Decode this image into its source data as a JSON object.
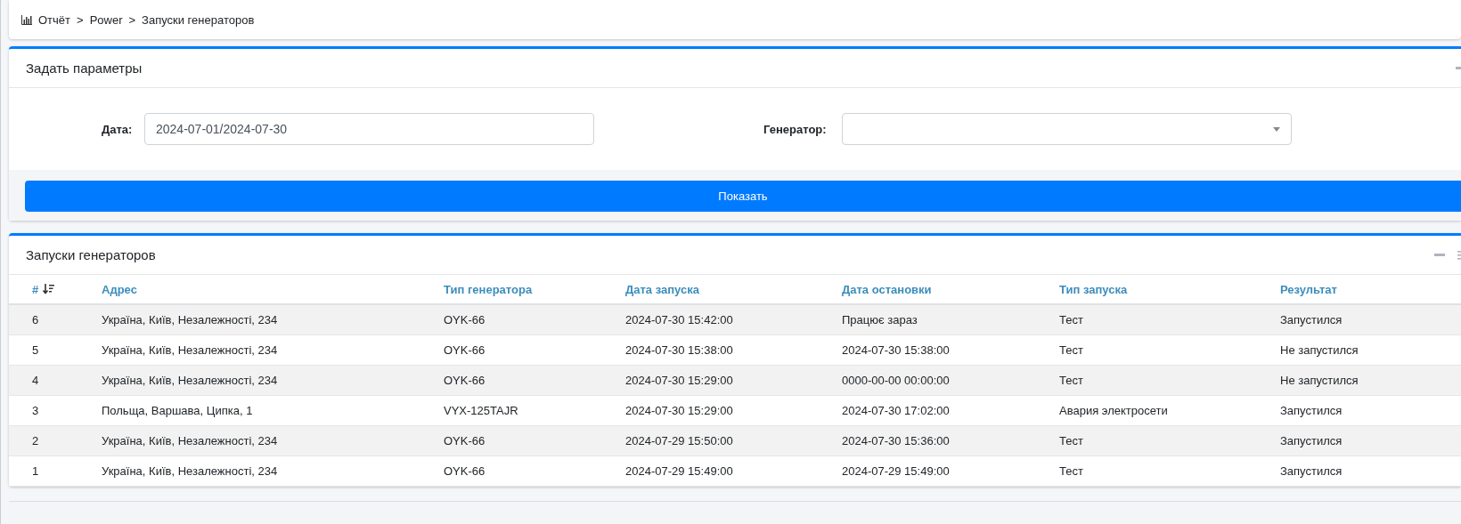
{
  "breadcrumb": [
    "Отчёт",
    "Power",
    "Запуски генераторов"
  ],
  "breadcrumb_separator": ">",
  "params_panel": {
    "title": "Задать параметры",
    "fields": [
      {
        "kind": "text",
        "label": "Дата:",
        "value": "2024-07-01/2024-07-30"
      },
      {
        "kind": "select",
        "label": "Генератор:"
      }
    ],
    "button": "Показать"
  },
  "table_panel": {
    "title": "Запуски генераторов",
    "columns": [
      {
        "label": "#",
        "sorted": true
      },
      {
        "label": "Адрес",
        "sorted": false
      },
      {
        "label": "Тип генератора",
        "sorted": false
      },
      {
        "label": "Дата запуска",
        "sorted": false
      },
      {
        "label": "Дата остановки",
        "sorted": false
      },
      {
        "label": "Тип запуска",
        "sorted": false
      },
      {
        "label": "Результат",
        "sorted": false
      }
    ],
    "rows": [
      [
        "6",
        "Україна, Київ, Незалежності, 234",
        "OYK-66",
        "2024-07-30 15:42:00",
        "Працює зараз",
        "Тест",
        "Запустился"
      ],
      [
        "5",
        "Україна, Київ, Незалежності, 234",
        "OYK-66",
        "2024-07-30 15:38:00",
        "2024-07-30 15:38:00",
        "Тест",
        "Не запустился"
      ],
      [
        "4",
        "Україна, Київ, Незалежності, 234",
        "OYK-66",
        "2024-07-30 15:29:00",
        "0000-00-00 00:00:00",
        "Тест",
        "Не запустился"
      ],
      [
        "3",
        "Польща, Варшава, Ципка, 1",
        "VYX-125TAJR",
        "2024-07-30 15:29:00",
        "2024-07-30 17:02:00",
        "Авария электросети",
        "Запустился"
      ],
      [
        "2",
        "Україна, Київ, Незалежності, 234",
        "OYK-66",
        "2024-07-29 15:50:00",
        "2024-07-30 15:36:00",
        "Тест",
        "Запустился"
      ],
      [
        "1",
        "Україна, Київ, Незалежності, 234",
        "OYK-66",
        "2024-07-29 15:49:00",
        "2024-07-29 15:49:00",
        "Тест",
        "Запустился"
      ]
    ]
  }
}
